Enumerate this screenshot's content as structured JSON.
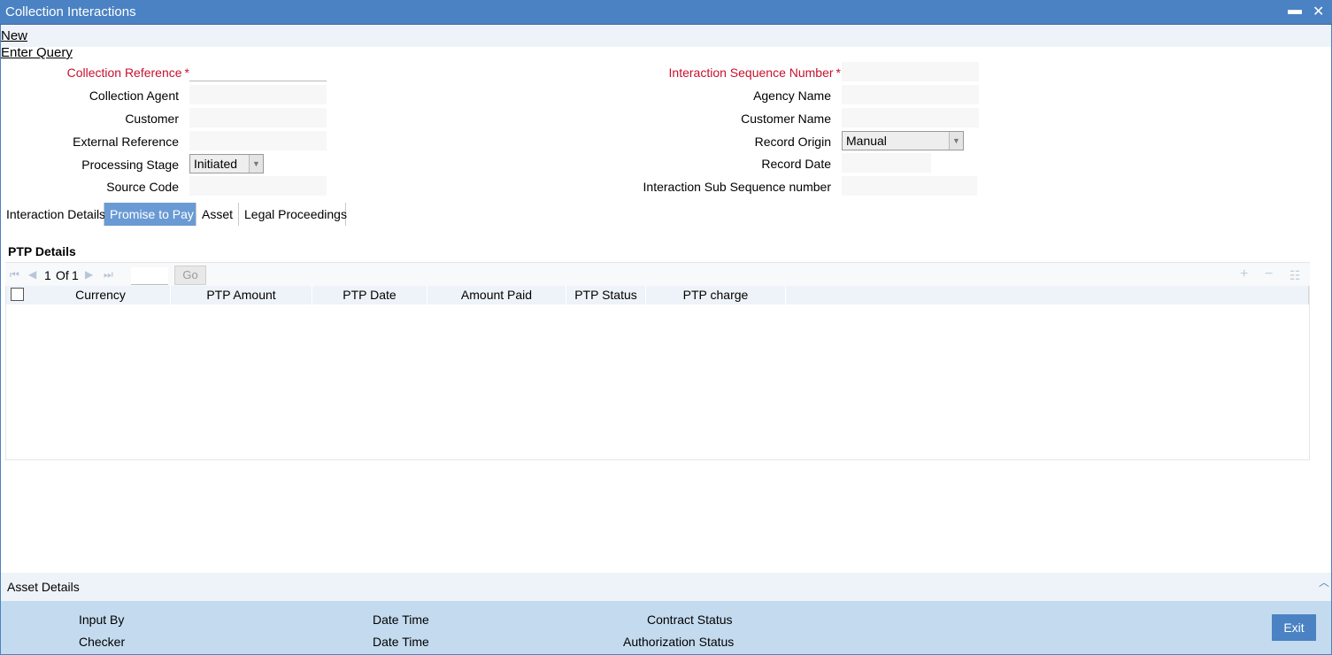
{
  "window": {
    "title": "Collection Interactions",
    "minimize_glyph": "▬",
    "close_glyph": "✕"
  },
  "menu": {
    "new_label": "New",
    "enter_query_label": "Enter Query"
  },
  "form": {
    "collection_reference": {
      "label": "Collection Reference",
      "value": ""
    },
    "collection_agent": {
      "label": "Collection Agent",
      "value": ""
    },
    "customer": {
      "label": "Customer",
      "value": ""
    },
    "external_reference": {
      "label": "External Reference",
      "value": ""
    },
    "processing_stage": {
      "label": "Processing Stage",
      "value": "Initiated"
    },
    "source_code": {
      "label": "Source Code",
      "value": ""
    },
    "interaction_sequence_number": {
      "label": "Interaction Sequence Number",
      "value": ""
    },
    "agency_name": {
      "label": "Agency Name",
      "value": ""
    },
    "customer_name": {
      "label": "Customer Name",
      "value": ""
    },
    "record_origin": {
      "label": "Record Origin",
      "value": "Manual"
    },
    "record_date": {
      "label": "Record Date",
      "value": ""
    },
    "interaction_sub_sequence_number": {
      "label": "Interaction Sub Sequence number",
      "value": ""
    },
    "required_marker": "*"
  },
  "tabs": [
    {
      "label": "Interaction Details",
      "active": false
    },
    {
      "label": "Promise to Pay",
      "active": true
    },
    {
      "label": "Asset",
      "active": false
    },
    {
      "label": "Legal Proceedings",
      "active": false
    }
  ],
  "ptp": {
    "section_title": "PTP Details",
    "pager": {
      "current": "1",
      "of_label": "Of",
      "total": "1",
      "go_label": "Go"
    },
    "columns": [
      "Currency",
      "PTP Amount",
      "PTP Date",
      "Amount Paid",
      "PTP Status",
      "PTP charge"
    ]
  },
  "asset_details": {
    "label": "Asset Details"
  },
  "footer": {
    "input_by_label": "Input By",
    "checker_label": "Checker",
    "date_time_label_1": "Date Time",
    "date_time_label_2": "Date Time",
    "contract_status_label": "Contract Status",
    "authorization_status_label": "Authorization Status",
    "exit_label": "Exit"
  },
  "colors": {
    "titlebar": "#4a82c3",
    "active_tab": "#6a9ad4",
    "required": "#c8102e",
    "footer": "#c4dbef"
  }
}
